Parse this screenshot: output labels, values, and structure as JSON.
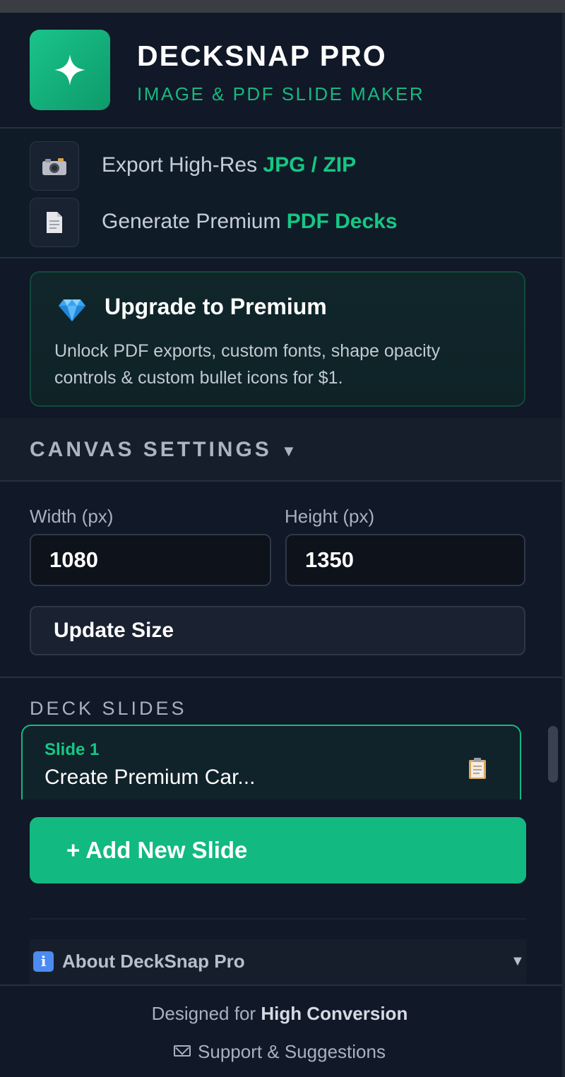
{
  "header": {
    "title": "DECKSNAP PRO",
    "subtitle": "IMAGE & PDF SLIDE MAKER",
    "logo_icon": "sparkle-icon"
  },
  "features": [
    {
      "icon": "camera-icon",
      "text": "Export High-Res ",
      "highlight": "JPG / ZIP"
    },
    {
      "icon": "document-icon",
      "text": "Generate Premium ",
      "highlight": "PDF Decks"
    }
  ],
  "premium": {
    "icon": "diamond-icon",
    "title": "Upgrade to Premium",
    "description": "Unlock PDF exports, custom fonts, shape opacity controls & custom bullet icons for $1."
  },
  "canvas_settings": {
    "label": "CANVAS SETTINGS",
    "caret": "▼",
    "width_label": "Width (px)",
    "width_value": "1080",
    "height_label": "Height (px)",
    "height_value": "1350",
    "update_button": "Update Size"
  },
  "deck": {
    "label": "DECK SLIDES",
    "slides": [
      {
        "number": "Slide 1",
        "title": "Create Premium Car...",
        "icon": "clipboard-icon"
      }
    ],
    "add_button": "+ Add New Slide"
  },
  "about": {
    "icon": "info-icon",
    "icon_glyph": "i",
    "label": "About DeckSnap Pro",
    "caret": "▼"
  },
  "footer": {
    "designed_prefix": "Designed for ",
    "designed_strong": "High Conversion",
    "support": "Support & Suggestions"
  },
  "colors": {
    "accent": "#16b981",
    "background": "#111827",
    "card": "#10222a"
  }
}
